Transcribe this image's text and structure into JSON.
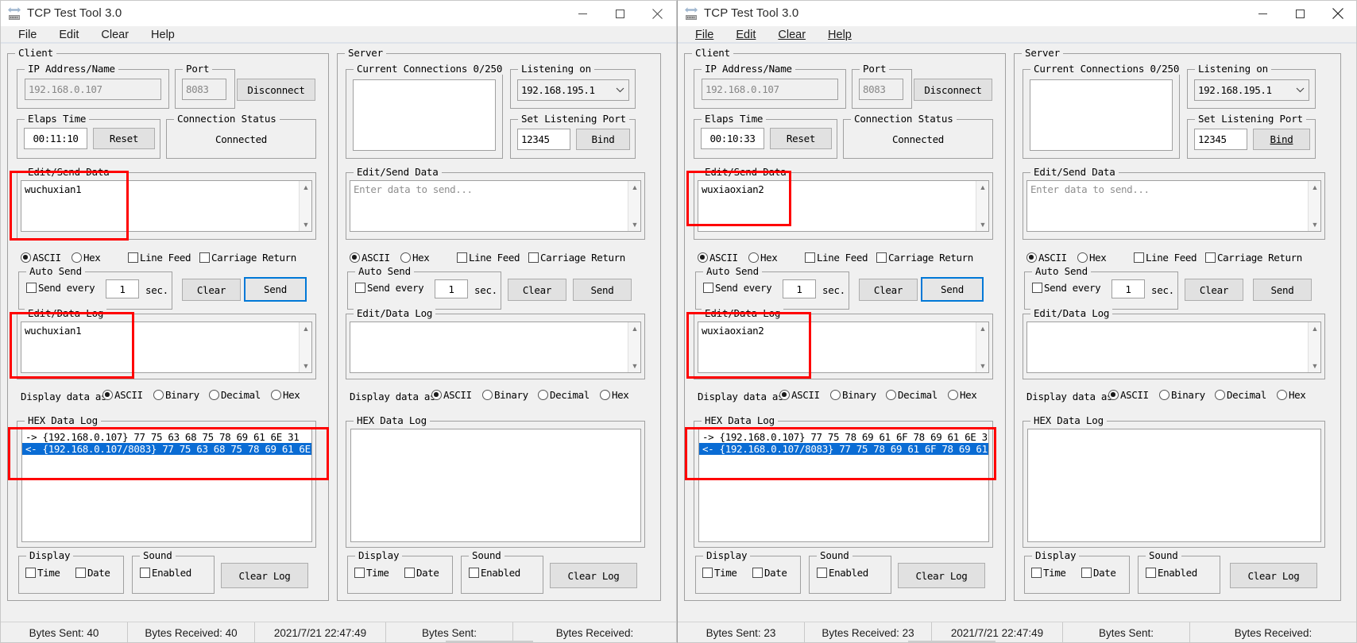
{
  "windows": [
    {
      "id": "left",
      "title": "TCP Test Tool 3.0",
      "menu": [
        {
          "label": "File",
          "accel": "F"
        },
        {
          "label": "Edit",
          "accel": "E"
        },
        {
          "label": "Clear",
          "accel": "C"
        },
        {
          "label": "Help",
          "accel": "H"
        }
      ],
      "menu_underline": false,
      "client": {
        "legend": "Client",
        "ip_group": "IP Address/Name",
        "ip_value": "192.168.0.107",
        "port_group": "Port",
        "port_value": "8083",
        "connect_button": "Disconnect",
        "elapsed_group": "Elaps Time",
        "elapsed_value": "00:11:10",
        "reset_button": "Reset",
        "status_group": "Connection Status",
        "status_value": "Connected",
        "send_group": "Edit/Send Data",
        "send_value": "wuchuxian1",
        "format_ascii": "ASCII",
        "format_hex": "Hex",
        "format_selected": "ASCII",
        "line_feed": "Line Feed",
        "carriage_return": "Carriage Return",
        "line_feed_checked": false,
        "carriage_return_checked": false,
        "auto_send_group": "Auto Send",
        "send_every": "Send every",
        "send_every_checked": false,
        "interval_value": "1",
        "sec_label": "sec.",
        "clear_button": "Clear",
        "send_button": "Send",
        "log_group": "Edit/Data Log",
        "log_value": "wuchuxian1",
        "display_data_label": "Display data as",
        "display_options": [
          "ASCII",
          "Binary",
          "Decimal",
          "Hex"
        ],
        "display_selected": "ASCII",
        "hex_group": "HEX Data Log",
        "hex_lines": [
          {
            "text": "-> {192.168.0.107}  77 75 63 68 75 78 69 61 6E 31",
            "selected": false
          },
          {
            "text": "<- {192.168.0.107/8083}  77 75 63 68 75 78 69 61 6E",
            "selected": true
          }
        ],
        "display_group": "Display",
        "time_label": "Time",
        "date_label": "Date",
        "time_checked": false,
        "date_checked": false,
        "sound_group": "Sound",
        "enabled_label": "Enabled",
        "enabled_checked": false,
        "clear_log_button": "Clear Log"
      },
      "server": {
        "legend": "Server",
        "connections_group": "Current Connections 0/250",
        "listening_group": "Listening on",
        "listening_value": "192.168.195.1",
        "set_port_group": "Set Listening Port",
        "set_port_value": "12345",
        "bind_button": "Bind",
        "send_group": "Edit/Send Data",
        "send_placeholder": "Enter data to send...",
        "format_ascii": "ASCII",
        "format_hex": "Hex",
        "format_selected": "ASCII",
        "line_feed": "Line Feed",
        "carriage_return": "Carriage Return",
        "auto_send_group": "Auto Send",
        "send_every": "Send every",
        "interval_value": "1",
        "sec_label": "sec.",
        "clear_button": "Clear",
        "send_button": "Send",
        "log_group": "Edit/Data Log",
        "log_value": "",
        "display_data_label": "Display data as",
        "display_options": [
          "ASCII",
          "Binary",
          "Decimal",
          "Hex"
        ],
        "display_selected": "ASCII",
        "hex_group": "HEX Data Log",
        "hex_lines": [],
        "display_group": "Display",
        "time_label": "Time",
        "date_label": "Date",
        "sound_group": "Sound",
        "enabled_label": "Enabled",
        "clear_log_button": "Clear Log"
      },
      "status": {
        "bytes_sent": "Bytes Sent: 40",
        "bytes_received": "Bytes Received: 40",
        "timestamp": "2021/7/21 22:47:49",
        "server_bytes_sent": "Bytes Sent:",
        "server_bytes_received": "Bytes Received:"
      }
    },
    {
      "id": "right",
      "title": "TCP Test Tool 3.0",
      "menu": [
        {
          "label": "File",
          "accel": "F"
        },
        {
          "label": "Edit",
          "accel": "E"
        },
        {
          "label": "Clear",
          "accel": "C"
        },
        {
          "label": "Help",
          "accel": "H"
        }
      ],
      "menu_underline": true,
      "client": {
        "legend": "Client",
        "ip_group": "IP Address/Name",
        "ip_value": "192.168.0.107",
        "port_group": "Port",
        "port_value": "8083",
        "connect_button": "Disconnect",
        "elapsed_group": "Elaps Time",
        "elapsed_value": "00:10:33",
        "reset_button": "Reset",
        "status_group": "Connection Status",
        "status_value": "Connected",
        "send_group": "Edit/Send Data",
        "send_value": "wuxiaoxian2",
        "format_ascii": "ASCII",
        "format_hex": "Hex",
        "format_selected": "ASCII",
        "line_feed": "Line Feed",
        "carriage_return": "Carriage Return",
        "line_feed_checked": false,
        "carriage_return_checked": false,
        "auto_send_group": "Auto Send",
        "send_every": "Send every",
        "send_every_checked": false,
        "interval_value": "1",
        "sec_label": "sec.",
        "clear_button": "Clear",
        "send_button": "Send",
        "log_group": "Edit/Data Log",
        "log_value": "wuxiaoxian2",
        "display_data_label": "Display data as",
        "display_options": [
          "ASCII",
          "Binary",
          "Decimal",
          "Hex"
        ],
        "display_selected": "ASCII",
        "hex_group": "HEX Data Log",
        "hex_lines": [
          {
            "text": "-> {192.168.0.107}  77 75 78 69 61 6F 78 69 61 6E 3",
            "selected": false
          },
          {
            "text": "<- {192.168.0.107/8083}  77 75 78 69 61 6F 78 69 61",
            "selected": true
          }
        ],
        "display_group": "Display",
        "time_label": "Time",
        "date_label": "Date",
        "time_checked": false,
        "date_checked": false,
        "sound_group": "Sound",
        "enabled_label": "Enabled",
        "enabled_checked": false,
        "clear_log_button": "Clear Log"
      },
      "server": {
        "legend": "Server",
        "connections_group": "Current Connections 0/250",
        "listening_group": "Listening on",
        "listening_value": "192.168.195.1",
        "set_port_group": "Set Listening Port",
        "set_port_value": "12345",
        "bind_button": "Bind",
        "send_group": "Edit/Send Data",
        "send_placeholder": "Enter data to send...",
        "format_ascii": "ASCII",
        "format_hex": "Hex",
        "format_selected": "ASCII",
        "line_feed": "Line Feed",
        "carriage_return": "Carriage Return",
        "auto_send_group": "Auto Send",
        "send_every": "Send every",
        "interval_value": "1",
        "sec_label": "sec.",
        "clear_button": "Clear",
        "send_button": "Send",
        "log_group": "Edit/Data Log",
        "log_value": "",
        "display_data_label": "Display data as",
        "display_options": [
          "ASCII",
          "Binary",
          "Decimal",
          "Hex"
        ],
        "display_selected": "ASCII",
        "hex_group": "HEX Data Log",
        "hex_lines": [],
        "display_group": "Display",
        "time_label": "Time",
        "date_label": "Date",
        "sound_group": "Sound",
        "enabled_label": "Enabled",
        "clear_log_button": "Clear Log"
      },
      "status": {
        "bytes_sent": "Bytes Sent: 23",
        "bytes_received": "Bytes Received: 23",
        "timestamp": "2021/7/21 22:47:49",
        "server_bytes_sent": "Bytes Sent:",
        "server_bytes_received": "Bytes Received:"
      }
    }
  ],
  "icons": {
    "minimize": "minimize-icon",
    "maximize": "maximize-icon",
    "close": "close-icon",
    "app": "network-app-icon",
    "scroll_up": "chevron-up-icon",
    "scroll_down": "chevron-down-icon",
    "combo_arrow": "chevron-down-icon"
  },
  "colors": {
    "accent": "#0078d7",
    "selection": "#0a6cd4",
    "annotation": "#ff0000",
    "window_bg": "#f0f0f0"
  }
}
